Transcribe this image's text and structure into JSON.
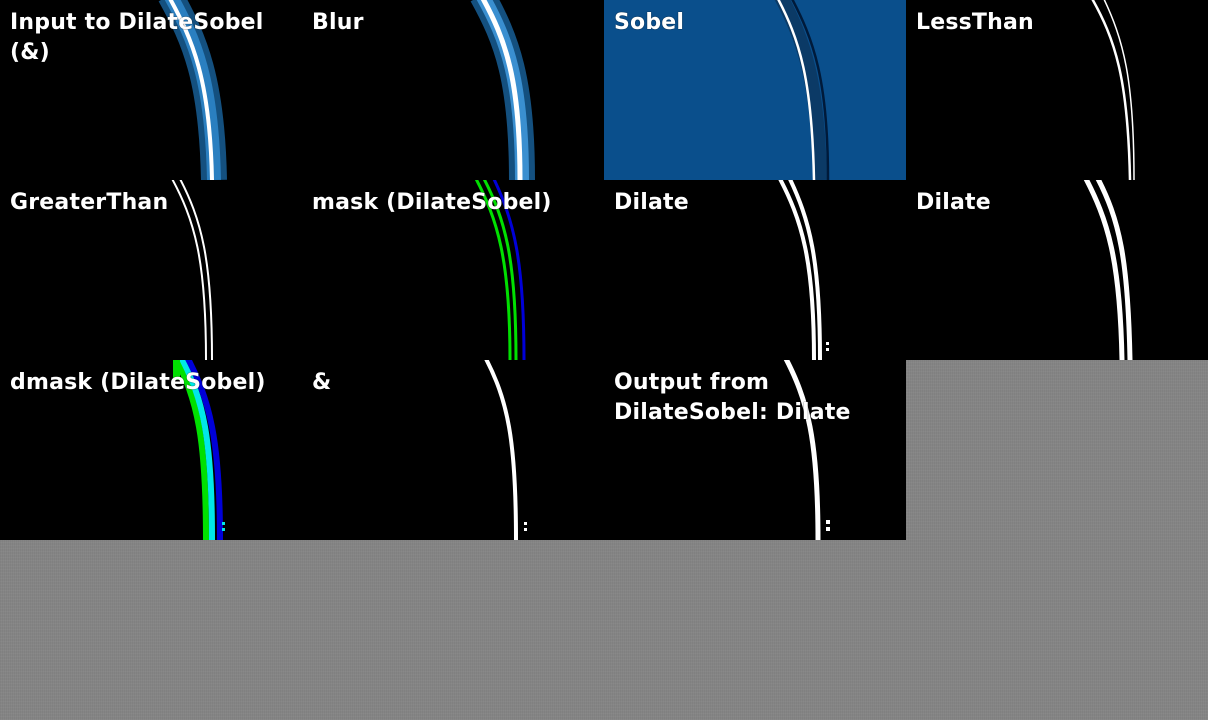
{
  "panels": [
    {
      "title": "Input to DilateSobel\n(&)"
    },
    {
      "title": "Blur"
    },
    {
      "title": "Sobel"
    },
    {
      "title": "LessThan"
    },
    {
      "title": "GreaterThan"
    },
    {
      "title": "mask (DilateSobel)"
    },
    {
      "title": "Dilate"
    },
    {
      "title": "Dilate"
    },
    {
      "title": "dmask (DilateSobel)"
    },
    {
      "title": "&"
    },
    {
      "title": "Output from\nDilateSobel: Dilate"
    }
  ],
  "colors": {
    "background": "#858585",
    "panel": "#000000",
    "sobel_panel": "#0a4f8c",
    "edge_blue": "#1e6fb0",
    "edge_white": "#ffffff",
    "mask_green": "#00e000",
    "mask_blue": "#0000d8",
    "dmask_cyan": "#00e8e8"
  }
}
